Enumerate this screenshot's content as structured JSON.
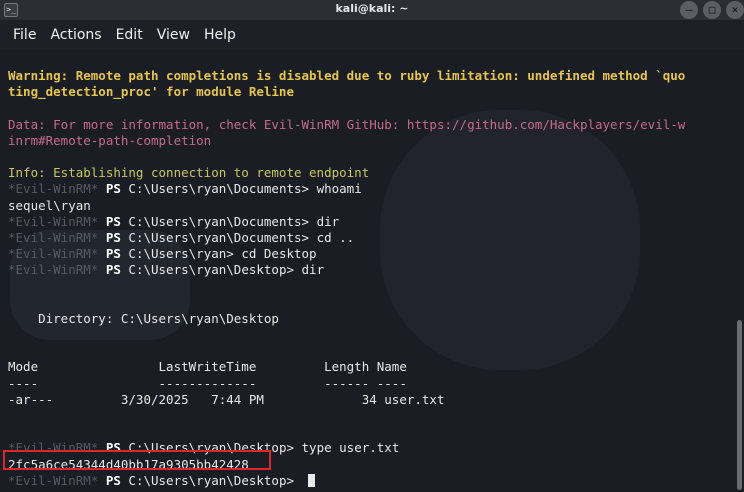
{
  "window": {
    "title": "kali@kali: ~"
  },
  "menu": [
    "File",
    "Actions",
    "Edit",
    "View",
    "Help"
  ],
  "prompt": {
    "name": "*Evil-WinRM*",
    "ps": "PS"
  },
  "terminal": {
    "warning_1": "Warning: Remote path completions is disabled due to ruby limitation: undefined method `quo",
    "warning_2": "ting_detection_proc' for module Reline",
    "data_1": "Data: For more information, check Evil-WinRM GitHub: https://github.com/Hackplayers/evil-w",
    "data_2": "inrm#Remote-path-completion",
    "info": "Info: Establishing connection to remote endpoint",
    "cmd_1": " C:\\Users\\ryan\\Documents> whoami",
    "out_1": "sequel\\ryan",
    "cmd_2": " C:\\Users\\ryan\\Documents> dir",
    "cmd_3": " C:\\Users\\ryan\\Documents> cd ..",
    "cmd_4": " C:\\Users\\ryan> cd Desktop",
    "cmd_5": " C:\\Users\\ryan\\Desktop> dir",
    "directory": "    Directory: C:\\Users\\ryan\\Desktop",
    "table_header": "Mode                LastWriteTime         Length Name",
    "table_dashes": "----                -------------         ------ ----",
    "table_row": "-ar---         3/30/2025   7:44 PM             34 user.txt",
    "cmd_6": " C:\\Users\\ryan\\Desktop> type user.txt",
    "hash": "2fc5a6ce54344d40bb17a9305bb42428",
    "cmd_7": " C:\\Users\\ryan\\Desktop> "
  },
  "colors": {
    "warning": "#e7c64a",
    "data": "#c76a8c",
    "info": "#c7c95a",
    "highlight": "#e0262a"
  }
}
